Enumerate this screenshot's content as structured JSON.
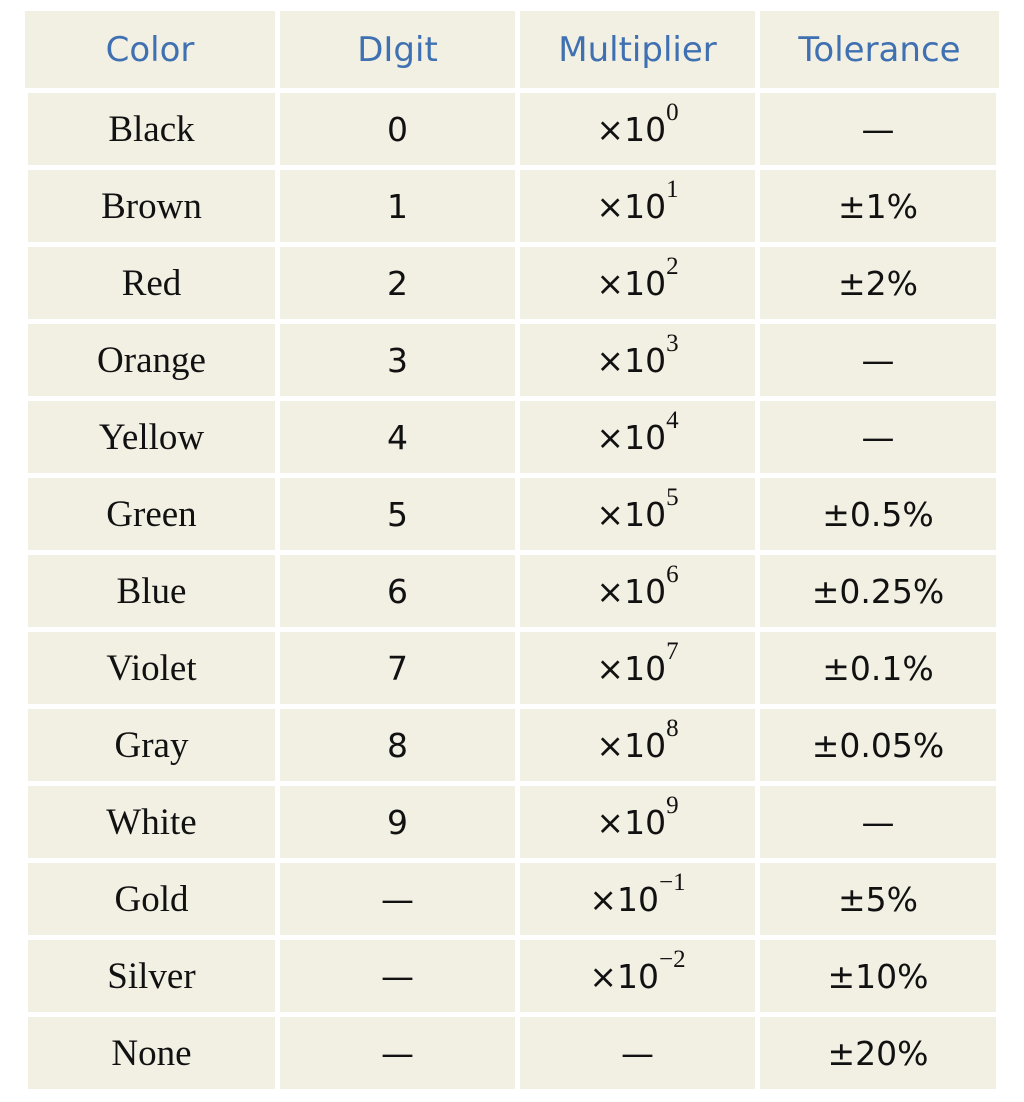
{
  "table": {
    "headers": [
      "Color",
      "DIgit",
      "Multiplier",
      "Tolerance"
    ],
    "rows": [
      {
        "color": "Black",
        "digit": "0",
        "multiplier_base": "×10",
        "multiplier_exp": "0",
        "tolerance": "—"
      },
      {
        "color": "Brown",
        "digit": "1",
        "multiplier_base": "×10",
        "multiplier_exp": "1",
        "tolerance": "±1%"
      },
      {
        "color": "Red",
        "digit": "2",
        "multiplier_base": "×10",
        "multiplier_exp": "2",
        "tolerance": "±2%"
      },
      {
        "color": "Orange",
        "digit": "3",
        "multiplier_base": "×10",
        "multiplier_exp": "3",
        "tolerance": "—"
      },
      {
        "color": "Yellow",
        "digit": "4",
        "multiplier_base": "×10",
        "multiplier_exp": "4",
        "tolerance": "—"
      },
      {
        "color": "Green",
        "digit": "5",
        "multiplier_base": "×10",
        "multiplier_exp": "5",
        "tolerance": "±0.5%"
      },
      {
        "color": "Blue",
        "digit": "6",
        "multiplier_base": "×10",
        "multiplier_exp": "6",
        "tolerance": "±0.25%"
      },
      {
        "color": "Violet",
        "digit": "7",
        "multiplier_base": "×10",
        "multiplier_exp": "7",
        "tolerance": "±0.1%"
      },
      {
        "color": "Gray",
        "digit": "8",
        "multiplier_base": "×10",
        "multiplier_exp": "8",
        "tolerance": "±0.05%"
      },
      {
        "color": "White",
        "digit": "9",
        "multiplier_base": "×10",
        "multiplier_exp": "9",
        "tolerance": "—"
      },
      {
        "color": "Gold",
        "digit": "—",
        "multiplier_base": "×10",
        "multiplier_exp": "−1",
        "tolerance": "±5%"
      },
      {
        "color": "Silver",
        "digit": "—",
        "multiplier_base": "×10",
        "multiplier_exp": "−2",
        "tolerance": "±10%"
      },
      {
        "color": "None",
        "digit": "—",
        "multiplier_base": "—",
        "multiplier_exp": "",
        "tolerance": "±20%"
      }
    ]
  },
  "colors": {
    "header_text": "#3f70b2",
    "cell_background": "#f2efe3",
    "body_text": "#111111"
  }
}
